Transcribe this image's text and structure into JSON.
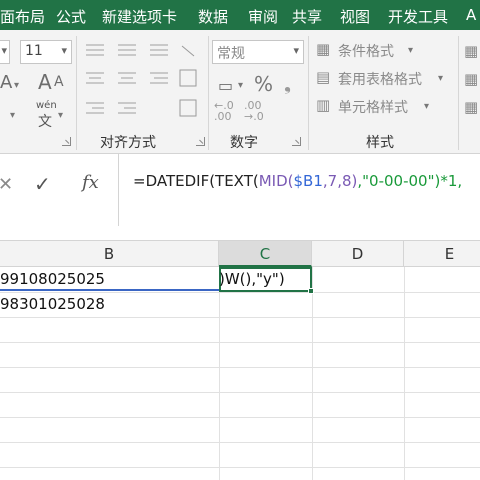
{
  "menu": {
    "items": [
      "面布局",
      "公式",
      "新建选项卡",
      "数据",
      "审阅",
      "共享",
      "视图",
      "开发工具",
      "A"
    ]
  },
  "ribbon": {
    "font_size_value": "11",
    "number_format_value": "常规",
    "percent_symbol": "%",
    "wen_label": "wén",
    "wen_char": "文",
    "conditional_format_label": "条件格式",
    "table_format_label": "套用表格格式",
    "cell_style_label": "单元格样式",
    "group_alignment": "对齐方式",
    "group_number": "数字",
    "group_styles": "样式"
  },
  "formula_bar": {
    "cancel_symbol": "✕",
    "confirm_symbol": "✓",
    "fx_label": "fx",
    "formula_part1": "=DATEDIF(TEXT(",
    "formula_mid": "MID(",
    "formula_ref": "$B1",
    "formula_args": ",7,8)",
    "formula_rest": ",\"0-00-00\")*1,"
  },
  "grid": {
    "columns": [
      "B",
      "C",
      "D",
      "E"
    ],
    "cells": {
      "b1": "99108025025",
      "b2": "98301025028",
      "c1": ")W(),\"y\")"
    }
  }
}
